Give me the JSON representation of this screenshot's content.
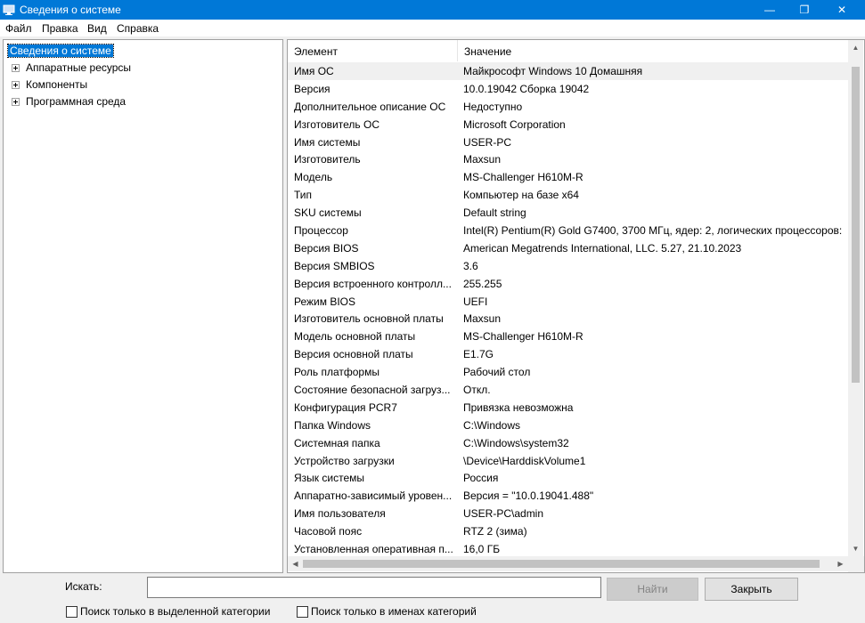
{
  "window": {
    "title": "Сведения о системе",
    "accent": "#0078d7",
    "min_glyph": "—",
    "max_glyph": "❐",
    "close_glyph": "✕"
  },
  "menu": [
    "Файл",
    "Правка",
    "Вид",
    "Справка"
  ],
  "tree": {
    "root": "Сведения о системе",
    "children": [
      "Аппаратные ресурсы",
      "Компоненты",
      "Программная среда"
    ]
  },
  "list": {
    "columns": [
      "Элемент",
      "Значение"
    ],
    "rows": [
      [
        "Имя ОС",
        "Майкрософт Windows 10 Домашняя"
      ],
      [
        "Версия",
        "10.0.19042 Сборка 19042"
      ],
      [
        "Дополнительное описание ОС",
        "Недоступно"
      ],
      [
        "Изготовитель ОС",
        "Microsoft Corporation"
      ],
      [
        "Имя системы",
        "USER-PC"
      ],
      [
        "Изготовитель",
        "Maxsun"
      ],
      [
        "Модель",
        "MS-Challenger H610M-R"
      ],
      [
        "Тип",
        "Компьютер на базе x64"
      ],
      [
        "SKU системы",
        "Default string"
      ],
      [
        "Процессор",
        "Intel(R) Pentium(R) Gold G7400, 3700 МГц, ядер: 2, логических процессоров:"
      ],
      [
        "Версия BIOS",
        "American Megatrends International, LLC. 5.27, 21.10.2023"
      ],
      [
        "Версия SMBIOS",
        "3.6"
      ],
      [
        "Версия встроенного контролл...",
        "255.255"
      ],
      [
        "Режим BIOS",
        "UEFI"
      ],
      [
        "Изготовитель основной платы",
        "Maxsun"
      ],
      [
        "Модель основной платы",
        "MS-Challenger H610M-R"
      ],
      [
        "Версия основной платы",
        "E1.7G"
      ],
      [
        "Роль платформы",
        "Рабочий стол"
      ],
      [
        "Состояние безопасной загруз...",
        "Откл."
      ],
      [
        "Конфигурация PCR7",
        "Привязка невозможна"
      ],
      [
        "Папка Windows",
        "C:\\Windows"
      ],
      [
        "Системная папка",
        "C:\\Windows\\system32"
      ],
      [
        "Устройство загрузки",
        "\\Device\\HarddiskVolume1"
      ],
      [
        "Язык системы",
        "Россия"
      ],
      [
        "Аппаратно-зависимый уровен...",
        "Версия = \"10.0.19041.488\""
      ],
      [
        "Имя пользователя",
        "USER-PC\\admin"
      ],
      [
        "Часовой пояс",
        "RTZ 2 (зима)"
      ],
      [
        "Установленная оперативная п...",
        "16,0 ГБ"
      ]
    ]
  },
  "search": {
    "label": "Искать:",
    "value": "",
    "find_button": "Найти",
    "close_button": "Закрыть",
    "option_selected_category": "Поиск только в выделенной категории",
    "option_category_names": "Поиск только в именах категорий"
  }
}
